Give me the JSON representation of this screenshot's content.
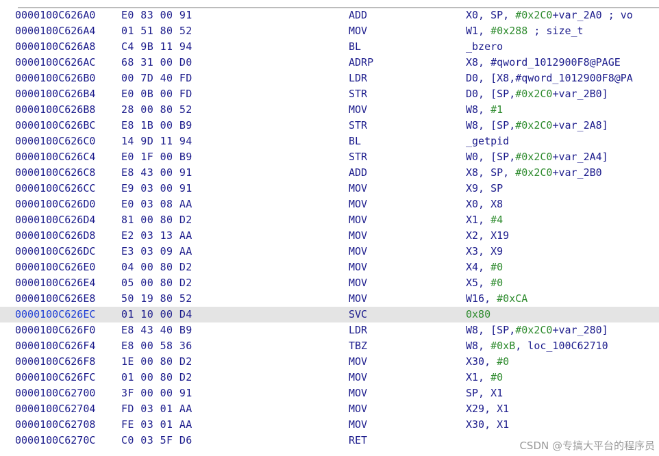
{
  "listing": {
    "selected_index": 19,
    "rows": [
      {
        "addr": "0000100C626A0",
        "bytes": "E0 83 00 91",
        "mnem": "ADD",
        "ops": [
          {
            "t": "X0, SP, "
          },
          {
            "t": "#0x2C0",
            "k": "imm"
          },
          {
            "t": "+var_2A0 ; vo"
          }
        ]
      },
      {
        "addr": "0000100C626A4",
        "bytes": "01 51 80 52",
        "mnem": "MOV",
        "ops": [
          {
            "t": "W1, "
          },
          {
            "t": "#0x288",
            "k": "imm"
          },
          {
            "t": " ; size_t"
          }
        ]
      },
      {
        "addr": "0000100C626A8",
        "bytes": "C4 9B 11 94",
        "mnem": "BL",
        "ops": [
          {
            "t": "_bzero"
          }
        ]
      },
      {
        "addr": "0000100C626AC",
        "bytes": "68 31 00 D0",
        "mnem": "ADRP",
        "ops": [
          {
            "t": "X8, #qword_1012900F8@PAGE"
          }
        ]
      },
      {
        "addr": "0000100C626B0",
        "bytes": "00 7D 40 FD",
        "mnem": "LDR",
        "ops": [
          {
            "t": "D0, [X8,#qword_1012900F8@PA"
          }
        ]
      },
      {
        "addr": "0000100C626B4",
        "bytes": "E0 0B 00 FD",
        "mnem": "STR",
        "ops": [
          {
            "t": "D0, [SP,"
          },
          {
            "t": "#0x2C0",
            "k": "imm"
          },
          {
            "t": "+var_2B0]"
          }
        ]
      },
      {
        "addr": "0000100C626B8",
        "bytes": "28 00 80 52",
        "mnem": "MOV",
        "ops": [
          {
            "t": "W8, "
          },
          {
            "t": "#1",
            "k": "imm"
          }
        ]
      },
      {
        "addr": "0000100C626BC",
        "bytes": "E8 1B 00 B9",
        "mnem": "STR",
        "ops": [
          {
            "t": "W8, [SP,"
          },
          {
            "t": "#0x2C0",
            "k": "imm"
          },
          {
            "t": "+var_2A8]"
          }
        ]
      },
      {
        "addr": "0000100C626C0",
        "bytes": "14 9D 11 94",
        "mnem": "BL",
        "ops": [
          {
            "t": "_getpid"
          }
        ]
      },
      {
        "addr": "0000100C626C4",
        "bytes": "E0 1F 00 B9",
        "mnem": "STR",
        "ops": [
          {
            "t": "W0, [SP,"
          },
          {
            "t": "#0x2C0",
            "k": "imm"
          },
          {
            "t": "+var_2A4]"
          }
        ]
      },
      {
        "addr": "0000100C626C8",
        "bytes": "E8 43 00 91",
        "mnem": "ADD",
        "ops": [
          {
            "t": "X8, SP, "
          },
          {
            "t": "#0x2C0",
            "k": "imm"
          },
          {
            "t": "+var_2B0"
          }
        ]
      },
      {
        "addr": "0000100C626CC",
        "bytes": "E9 03 00 91",
        "mnem": "MOV",
        "ops": [
          {
            "t": "X9, SP"
          }
        ]
      },
      {
        "addr": "0000100C626D0",
        "bytes": "E0 03 08 AA",
        "mnem": "MOV",
        "ops": [
          {
            "t": "X0, X8"
          }
        ]
      },
      {
        "addr": "0000100C626D4",
        "bytes": "81 00 80 D2",
        "mnem": "MOV",
        "ops": [
          {
            "t": "X1, "
          },
          {
            "t": "#4",
            "k": "imm"
          }
        ]
      },
      {
        "addr": "0000100C626D8",
        "bytes": "E2 03 13 AA",
        "mnem": "MOV",
        "ops": [
          {
            "t": "X2, X19"
          }
        ]
      },
      {
        "addr": "0000100C626DC",
        "bytes": "E3 03 09 AA",
        "mnem": "MOV",
        "ops": [
          {
            "t": "X3, X9"
          }
        ]
      },
      {
        "addr": "0000100C626E0",
        "bytes": "04 00 80 D2",
        "mnem": "MOV",
        "ops": [
          {
            "t": "X4, "
          },
          {
            "t": "#0",
            "k": "imm"
          }
        ]
      },
      {
        "addr": "0000100C626E4",
        "bytes": "05 00 80 D2",
        "mnem": "MOV",
        "ops": [
          {
            "t": "X5, "
          },
          {
            "t": "#0",
            "k": "imm"
          }
        ]
      },
      {
        "addr": "0000100C626E8",
        "bytes": "50 19 80 52",
        "mnem": "MOV",
        "ops": [
          {
            "t": "W16, "
          },
          {
            "t": "#0xCA",
            "k": "imm"
          }
        ]
      },
      {
        "addr": "0000100C626EC",
        "bytes": "01 10 00 D4",
        "mnem": "SVC",
        "ops": [
          {
            "t": "0x80",
            "k": "imm"
          }
        ]
      },
      {
        "addr": "0000100C626F0",
        "bytes": "E8 43 40 B9",
        "mnem": "LDR",
        "ops": [
          {
            "t": "W8, [SP,"
          },
          {
            "t": "#0x2C0",
            "k": "imm"
          },
          {
            "t": "+var_280]"
          }
        ]
      },
      {
        "addr": "0000100C626F4",
        "bytes": "E8 00 58 36",
        "mnem": "TBZ",
        "ops": [
          {
            "t": "W8, "
          },
          {
            "t": "#0xB",
            "k": "imm"
          },
          {
            "t": ", loc_100C62710"
          }
        ]
      },
      {
        "addr": "0000100C626F8",
        "bytes": "1E 00 80 D2",
        "mnem": "MOV",
        "ops": [
          {
            "t": "X30, "
          },
          {
            "t": "#0",
            "k": "imm"
          }
        ]
      },
      {
        "addr": "0000100C626FC",
        "bytes": "01 00 80 D2",
        "mnem": "MOV",
        "ops": [
          {
            "t": "X1, "
          },
          {
            "t": "#0",
            "k": "imm"
          }
        ]
      },
      {
        "addr": "0000100C62700",
        "bytes": "3F 00 00 91",
        "mnem": "MOV",
        "ops": [
          {
            "t": "SP, X1"
          }
        ]
      },
      {
        "addr": "0000100C62704",
        "bytes": "FD 03 01 AA",
        "mnem": "MOV",
        "ops": [
          {
            "t": "X29, X1"
          }
        ]
      },
      {
        "addr": "0000100C62708",
        "bytes": "FE 03 01 AA",
        "mnem": "MOV",
        "ops": [
          {
            "t": "X30, X1"
          }
        ]
      },
      {
        "addr": "0000100C6270C",
        "bytes": "C0 03 5F D6",
        "mnem": "RET",
        "ops": []
      }
    ]
  },
  "watermark": "CSDN @专搞大平台的程序员",
  "colors": {
    "text": "#1c1c8c",
    "immediate": "#2e8b2e",
    "selected_row_bg": "#e4e4e4",
    "selected_addr": "#1f3fd6"
  }
}
